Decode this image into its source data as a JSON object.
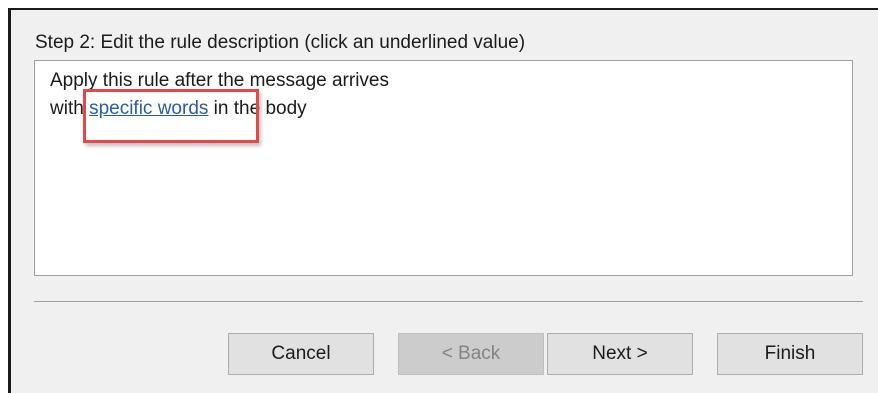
{
  "step": {
    "label": "Step 2: Edit the rule description (click an underlined value)"
  },
  "description": {
    "line1": "Apply this rule after the message arrives",
    "line2_prefix": "with ",
    "line2_link": "specific words",
    "line2_suffix": " in the body"
  },
  "buttons": {
    "cancel": "Cancel",
    "back": "< Back",
    "next": "Next >",
    "finish": "Finish"
  },
  "colors": {
    "link": "#2a5caa",
    "highlight_border": "#e0484a",
    "panel_background": "#f0f0f0"
  }
}
